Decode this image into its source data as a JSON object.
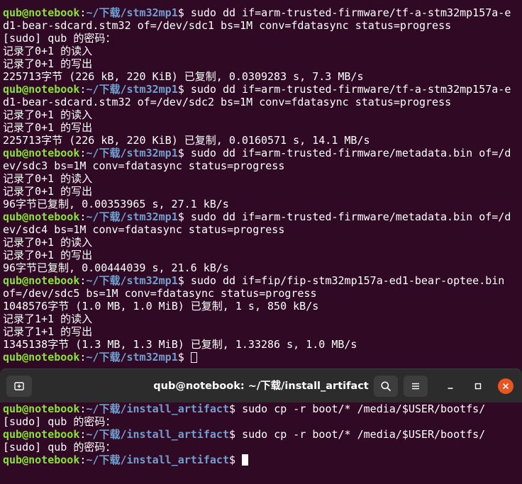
{
  "top_terminal": {
    "lines": [
      {
        "type": "prompt",
        "user": "qub@notebook",
        "sep": ":",
        "path": "~/下载/stm32mp1",
        "sym": "$ ",
        "cmd": "sudo dd if=arm-trusted-firmware/tf-a-stm32mp157a-e"
      },
      {
        "type": "text",
        "text": "d1-bear-sdcard.stm32 of=/dev/sdc1 bs=1M conv=fdatasync status=progress"
      },
      {
        "type": "text",
        "text": "[sudo] qub 的密码："
      },
      {
        "type": "text",
        "text": "记录了0+1 的读入"
      },
      {
        "type": "text",
        "text": "记录了0+1 的写出"
      },
      {
        "type": "text",
        "text": "225713字节 (226 kB, 220 KiB) 已复制, 0.0309283 s, 7.3 MB/s"
      },
      {
        "type": "prompt",
        "user": "qub@notebook",
        "sep": ":",
        "path": "~/下载/stm32mp1",
        "sym": "$ ",
        "cmd": "sudo dd if=arm-trusted-firmware/tf-a-stm32mp157a-e"
      },
      {
        "type": "text",
        "text": "d1-bear-sdcard.stm32 of=/dev/sdc2 bs=1M conv=fdatasync status=progress"
      },
      {
        "type": "text",
        "text": "记录了0+1 的读入"
      },
      {
        "type": "text",
        "text": "记录了0+1 的写出"
      },
      {
        "type": "text",
        "text": "225713字节 (226 kB, 220 KiB) 已复制, 0.0160571 s, 14.1 MB/s"
      },
      {
        "type": "prompt",
        "user": "qub@notebook",
        "sep": ":",
        "path": "~/下载/stm32mp1",
        "sym": "$ ",
        "cmd": "sudo dd if=arm-trusted-firmware/metadata.bin of=/d"
      },
      {
        "type": "text",
        "text": "ev/sdc3 bs=1M conv=fdatasync status=progress"
      },
      {
        "type": "text",
        "text": "记录了0+1 的读入"
      },
      {
        "type": "text",
        "text": "记录了0+1 的写出"
      },
      {
        "type": "text",
        "text": "96字节已复制, 0.00353965 s, 27.1 kB/s"
      },
      {
        "type": "prompt",
        "user": "qub@notebook",
        "sep": ":",
        "path": "~/下载/stm32mp1",
        "sym": "$ ",
        "cmd": "sudo dd if=arm-trusted-firmware/metadata.bin of=/d"
      },
      {
        "type": "text",
        "text": "ev/sdc4 bs=1M conv=fdatasync status=progress"
      },
      {
        "type": "text",
        "text": "记录了0+1 的读入"
      },
      {
        "type": "text",
        "text": "记录了0+1 的写出"
      },
      {
        "type": "text",
        "text": "96字节已复制, 0.00444039 s, 21.6 kB/s"
      },
      {
        "type": "prompt",
        "user": "qub@notebook",
        "sep": ":",
        "path": "~/下载/stm32mp1",
        "sym": "$ ",
        "cmd": "sudo dd if=fip/fip-stm32mp157a-ed1-bear-optee.bin"
      },
      {
        "type": "text",
        "text": "of=/dev/sdc5 bs=1M conv=fdatasync status=progress"
      },
      {
        "type": "text",
        "text": "1048576字节 (1.0 MB, 1.0 MiB) 已复制, 1 s, 850 kB/s"
      },
      {
        "type": "text",
        "text": "记录了1+1 的读入"
      },
      {
        "type": "text",
        "text": "记录了1+1 的写出"
      },
      {
        "type": "text",
        "text": "1345138字节 (1.3 MB, 1.3 MiB) 已复制, 1.33286 s, 1.0 MB/s"
      },
      {
        "type": "prompt",
        "user": "qub@notebook",
        "sep": ":",
        "path": "~/下载/stm32mp1",
        "sym": "$ ",
        "cmd": "",
        "cursor": "outline"
      }
    ]
  },
  "window": {
    "title": "qub@notebook: ~/下载/install_artifact",
    "icons": {
      "new_tab": "new-tab-icon",
      "search": "search-icon",
      "menu": "hamburger-menu-icon",
      "minimize": "minimize-icon",
      "maximize": "maximize-icon",
      "close": "close-icon"
    },
    "colors": {
      "close": "#e95420",
      "titlebar": "#2c2c2c",
      "terminal_bg": "#300a24",
      "user": "#8ae234",
      "path": "#729fcf"
    }
  },
  "bottom_terminal": {
    "lines": [
      {
        "type": "prompt",
        "user": "qub@notebook",
        "sep": ":",
        "path": "~/下载/install_artifact",
        "sym": "$ ",
        "cmd": "sudo cp -r boot/* /media/$USER/bootfs/"
      },
      {
        "type": "text",
        "text": "[sudo] qub 的密码："
      },
      {
        "type": "prompt",
        "user": "qub@notebook",
        "sep": ":",
        "path": "~/下载/install_artifact",
        "sym": "$ ",
        "cmd": "sudo cp -r boot/* /media/$USER/bootfs/"
      },
      {
        "type": "text",
        "text": "[sudo] qub 的密码："
      },
      {
        "type": "prompt",
        "user": "qub@notebook",
        "sep": ":",
        "path": "~/下载/install_artifact",
        "sym": "$ ",
        "cmd": "",
        "cursor": "solid"
      }
    ]
  }
}
